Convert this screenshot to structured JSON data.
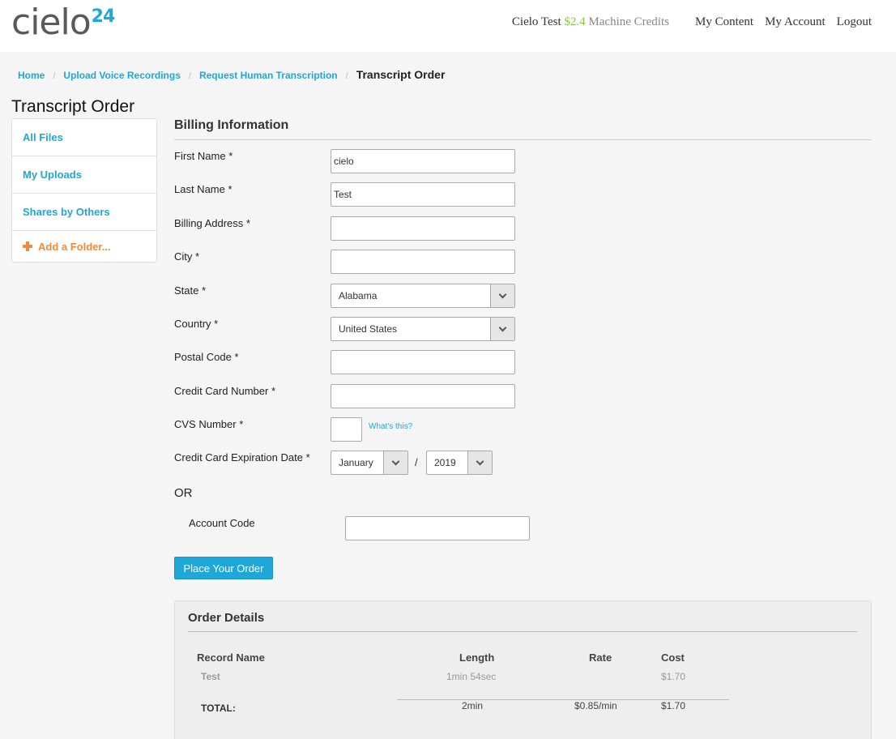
{
  "header": {
    "logo_word": "cielo",
    "logo_num": "24",
    "user_name": "Cielo Test",
    "credits_amount": "$2.4",
    "credits_label": "Machine Credits",
    "nav": [
      "My Content",
      "My Account",
      "Logout"
    ]
  },
  "breadcrumb": {
    "items": [
      "Home",
      "Upload Voice Recordings",
      "Request Human Transcription"
    ],
    "separator": "/",
    "current": "Transcript Order"
  },
  "page_title": "Transcript Order",
  "sidebar": {
    "items": [
      "All Files",
      "My Uploads",
      "Shares by Others"
    ],
    "add_folder": "Add a Folder..."
  },
  "billing": {
    "title": "Billing Information",
    "first_name": {
      "label": "First Name",
      "value": "cielo"
    },
    "last_name": {
      "label": "Last Name",
      "value": "Test"
    },
    "address": {
      "label": "Billing Address",
      "value": ""
    },
    "city": {
      "label": "City",
      "value": ""
    },
    "state": {
      "label": "State",
      "value": "Alabama"
    },
    "country": {
      "label": "Country",
      "value": "United States"
    },
    "postal": {
      "label": "Postal Code",
      "value": ""
    },
    "card": {
      "label": "Credit Card Number",
      "value": ""
    },
    "cvs": {
      "label": "CVS Number",
      "value": "",
      "help": "What's this?"
    },
    "expiry": {
      "label": "Credit Card Expiration Date",
      "month": "January",
      "separator": "/",
      "year": "2019"
    },
    "required_mark": "*",
    "or_label": "OR",
    "account_code": {
      "label": "Account Code",
      "value": ""
    },
    "submit_label": "Place Your Order"
  },
  "order": {
    "title": "Order Details",
    "headers": [
      "Record Name",
      "Length",
      "Rate",
      "Cost"
    ],
    "rows": [
      {
        "name": "Test",
        "length": "1min 54sec",
        "rate": "",
        "cost": "$1.70"
      }
    ],
    "total": {
      "label": "TOTAL:",
      "length": "2min",
      "rate": "$0.85/min",
      "cost": "$1.70"
    }
  },
  "colors": {
    "accent": "#1ea7d8",
    "add_folder": "#f08a3e",
    "credits": "#8bc34a"
  }
}
